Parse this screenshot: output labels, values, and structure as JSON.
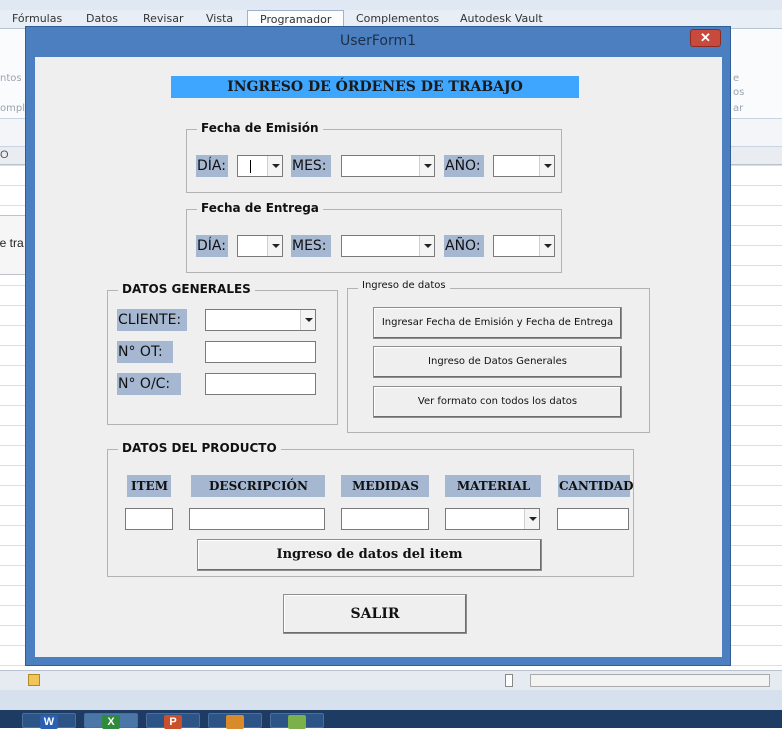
{
  "excel": {
    "ribbon_tabs": [
      "Fórmulas",
      "Datos",
      "Revisar",
      "Vista",
      "Programador",
      "Complementos",
      "Autodesk Vault"
    ],
    "active_tab": "Programador",
    "ribbon_fragments": {
      "left_top": "ntos",
      "left_bottom": "omple",
      "right_top": "e",
      "right_mid": "os",
      "right_bottom": "ar"
    },
    "column_letter": "O",
    "shape_text": "le tra"
  },
  "userform": {
    "title": "UserForm1",
    "close_glyph": "✕",
    "heading": "INGRESO DE ÓRDENES DE TRABAJO",
    "fecha_emision": {
      "label": "Fecha de Emisión",
      "dia": "DÍA:",
      "mes": "MES:",
      "anio": "AÑO:"
    },
    "fecha_entrega": {
      "label": "Fecha de Entrega",
      "dia": "DÍA:",
      "mes": "MES:",
      "anio": "AÑO:"
    },
    "datos_generales": {
      "label": "DATOS GENERALES",
      "cliente": "CLIENTE:",
      "ot": "N° OT:",
      "oc": "N° O/C:"
    },
    "ingreso_datos": {
      "label": "Ingreso de datos",
      "btn_fechas": "Ingresar Fecha de Emisión y Fecha de Entrega",
      "btn_generales": "Ingreso de Datos Generales",
      "btn_formato": "Ver formato con todos los datos"
    },
    "datos_producto": {
      "label": "DATOS DEL PRODUCTO",
      "columns": [
        "ITEM",
        "DESCRIPCIÓN",
        "MEDIDAS",
        "MATERIAL",
        "CANTIDAD"
      ],
      "btn_item": "Ingreso de datos del item"
    },
    "salir": "SALIR"
  },
  "colors": {
    "heading_bg": "#3ea6ff",
    "label_bg": "#a5b7d1",
    "window_border": "#4b7fbf",
    "close_button": "#c84a3d"
  }
}
